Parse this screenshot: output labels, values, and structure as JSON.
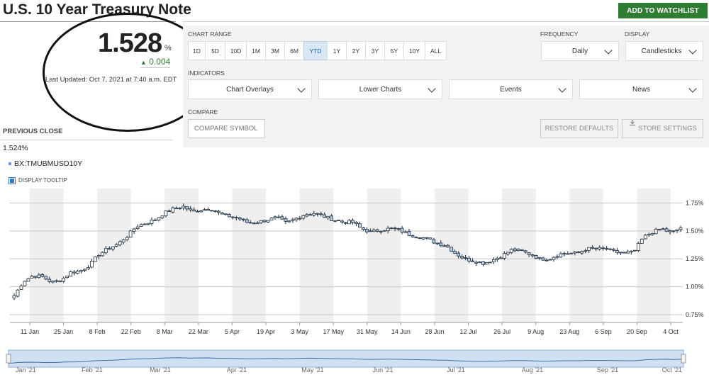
{
  "header": {
    "title": "U.S. 10 Year Treasury Note",
    "watchlist_label": "ADD TO WATCHLIST"
  },
  "quote": {
    "price": "1.528",
    "unit": "%",
    "change": "0.004",
    "change_arrow": "▲",
    "last_updated": "Last Updated: Oct 7, 2021 at 7:40 a.m. EDT",
    "previous_close_label": "PREVIOUS CLOSE",
    "previous_close_value": "1.524%"
  },
  "controls": {
    "chart_range_label": "CHART RANGE",
    "ranges": [
      "1D",
      "5D",
      "10D",
      "1M",
      "3M",
      "6M",
      "YTD",
      "1Y",
      "2Y",
      "3Y",
      "5Y",
      "10Y",
      "ALL"
    ],
    "active_range": "YTD",
    "frequency_label": "FREQUENCY",
    "frequency_value": "Daily",
    "display_label": "DISPLAY",
    "display_value": "Candlesticks",
    "indicators_label": "INDICATORS",
    "indicators": [
      "Chart Overlays",
      "Lower Charts",
      "Events",
      "News"
    ],
    "compare_label": "COMPARE",
    "compare_placeholder": "COMPARE SYMBOL",
    "restore_label": "RESTORE DEFAULTS",
    "store_label": "STORE SETTINGS"
  },
  "legend": {
    "symbol": "BX:TMUBMUSD10Y",
    "tooltip_label": "DISPLAY TOOLTIP"
  },
  "colors": {
    "accent_green": "#2e7d32",
    "candle_fill": "#b7cde3",
    "candle_stroke": "#1c2c3d",
    "band": "#efefef",
    "annotation": "#111111"
  },
  "chart_data": {
    "type": "candlestick",
    "title": "",
    "xlabel": "",
    "ylabel": "",
    "yaxis": {
      "ticks": [
        "0.75%",
        "1.00%",
        "1.25%",
        "1.50%",
        "1.75%"
      ],
      "values": [
        0.75,
        1.0,
        1.25,
        1.5,
        1.75
      ],
      "range": [
        0.68,
        1.88
      ]
    },
    "xaxis": {
      "tick_labels": [
        "11 Jan",
        "25 Jan",
        "8 Feb",
        "22 Feb",
        "8 Mar",
        "22 Mar",
        "5 Apr",
        "19 Apr",
        "3 May",
        "17 May",
        "31 May",
        "14 Jun",
        "28 Jun",
        "12 Jul",
        "26 Jul",
        "9 Aug",
        "23 Aug",
        "6 Sep",
        "20 Sep",
        "4 Oct"
      ],
      "start": "2021-01-04",
      "end": "2021-10-07"
    },
    "closes": [
      0.92,
      1.05,
      1.1,
      1.09,
      1.04,
      1.06,
      1.13,
      1.14,
      1.19,
      1.29,
      1.34,
      1.38,
      1.45,
      1.54,
      1.57,
      1.6,
      1.66,
      1.7,
      1.72,
      1.67,
      1.69,
      1.7,
      1.65,
      1.63,
      1.61,
      1.57,
      1.58,
      1.6,
      1.62,
      1.57,
      1.61,
      1.65,
      1.66,
      1.63,
      1.6,
      1.58,
      1.58,
      1.52,
      1.49,
      1.51,
      1.52,
      1.51,
      1.47,
      1.45,
      1.43,
      1.39,
      1.37,
      1.3,
      1.25,
      1.23,
      1.21,
      1.24,
      1.28,
      1.33,
      1.32,
      1.29,
      1.25,
      1.25,
      1.29,
      1.3,
      1.3,
      1.34,
      1.34,
      1.34,
      1.31,
      1.3,
      1.31,
      1.44,
      1.49,
      1.52,
      1.48,
      1.53
    ],
    "ohlc_note_count": 72,
    "navigator": {
      "tick_labels": [
        "Jan '21",
        "Feb '21",
        "Mar '21",
        "Apr '21",
        "May '21",
        "Jun '21",
        "Jul '21",
        "Aug '21",
        "Sep '21",
        "Oct '21"
      ]
    }
  }
}
